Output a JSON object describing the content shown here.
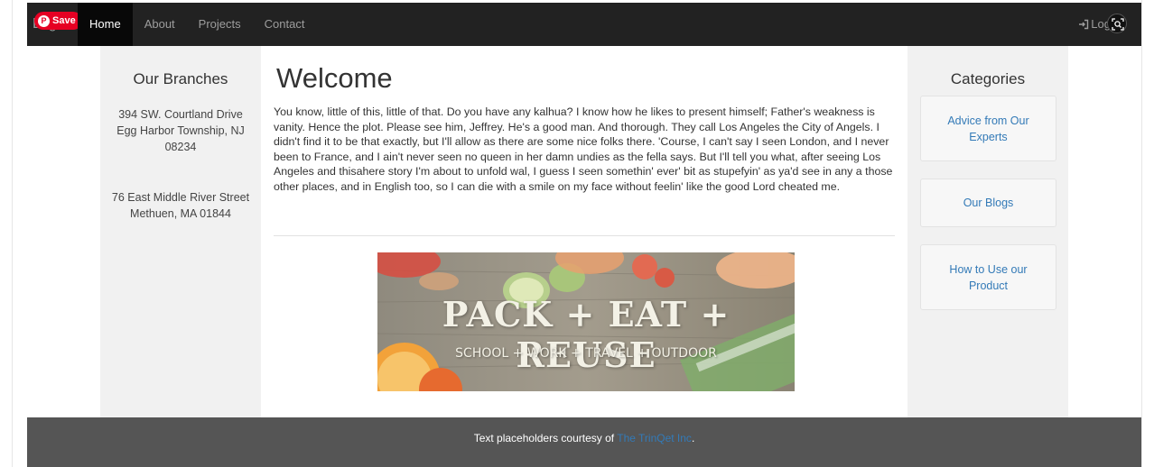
{
  "navbar": {
    "brand": "Logo",
    "save_label": "Save",
    "items": [
      {
        "label": "Home",
        "active": true
      },
      {
        "label": "About"
      },
      {
        "label": "Projects"
      },
      {
        "label": "Contact"
      }
    ],
    "login_label": "Log"
  },
  "branches": {
    "heading": "Our Branches",
    "addresses": [
      "394 SW. Courtland Drive Egg Harbor Township, NJ 08234",
      "76 East Middle River Street Methuen, MA 01844"
    ]
  },
  "main": {
    "title": "Welcome",
    "body": "You know, little of this, little of that. Do you have any kalhua? I know how he likes to present himself; Father's weakness is vanity. Hence the plot. Please see him, Jeffrey. He's a good man. And thorough. They call Los Angeles the City of Angels. I didn't find it to be that exactly, but I'll allow as there are some nice folks there. 'Course, I can't say I seen London, and I never been to France, and I ain't never seen no queen in her damn undies as the fella says. But I'll tell you what, after seeing Los Angeles and thisahere story I'm about to unfold wal, I guess I seen somethin' ever' bit as stupefyin' as ya'd see in any a those other places, and in English too, so I can die with a smile on my face without feelin' like the good Lord cheated me.",
    "banner": {
      "title": "PACK + EAT + REUSE",
      "subtitle": "SCHOOL + WORK + TRAVEL + OUTDOOR"
    }
  },
  "categories": {
    "heading": "Categories",
    "items": [
      "Advice from Our Experts",
      "Our Blogs",
      "How to Use our Product"
    ]
  },
  "footer": {
    "text": "Text placeholders courtesy of ",
    "link": "The TrinQet Inc",
    "suffix": "."
  },
  "colors": {
    "navbar": "#222222",
    "footer": "#555555",
    "sidebar": "#f1f1f1",
    "link": "#337ab7",
    "save": "#e60023"
  }
}
